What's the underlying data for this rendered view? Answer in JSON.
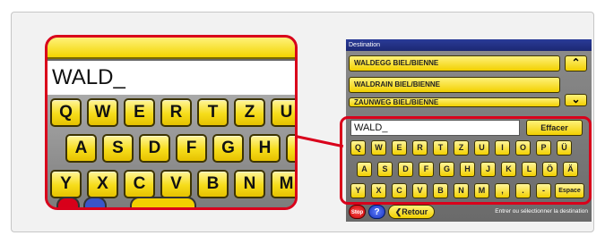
{
  "zoom": {
    "input_value": "WALD_",
    "rows": [
      [
        "Q",
        "W",
        "E",
        "R",
        "T",
        "Z",
        "U"
      ],
      [
        "A",
        "S",
        "D",
        "F",
        "G",
        "H",
        "J"
      ],
      [
        "Y",
        "X",
        "C",
        "V",
        "B",
        "N",
        "M"
      ]
    ]
  },
  "device": {
    "header_title": "Destination",
    "results": [
      "WALDEGG BIEL/BIENNE",
      "WALDRAIN BIEL/BIENNE",
      "ZAUNWEG BIEL/BIENNE"
    ],
    "scroll_up_icon": "caret-up-icon",
    "scroll_down_icon": "caret-down-icon",
    "input_value": "WALD_",
    "clear_label": "Effacer",
    "rows": [
      [
        "Q",
        "W",
        "E",
        "R",
        "T",
        "Z",
        "U",
        "I",
        "O",
        "P",
        "Ü"
      ],
      [
        "A",
        "S",
        "D",
        "F",
        "G",
        "H",
        "J",
        "K",
        "L",
        "Ö",
        "Ä"
      ],
      [
        "Y",
        "X",
        "C",
        "V",
        "B",
        "N",
        "M",
        ",",
        ".",
        "-"
      ]
    ],
    "space_label": "Espace",
    "stop_label": "Stop",
    "help_label": "?",
    "back_label": "Retour",
    "status_text": "Entrer ou sélectionner la destination"
  },
  "colors": {
    "accent_red": "#d9001b",
    "key_yellow": "#f2d400",
    "header_blue": "#1c2873"
  }
}
